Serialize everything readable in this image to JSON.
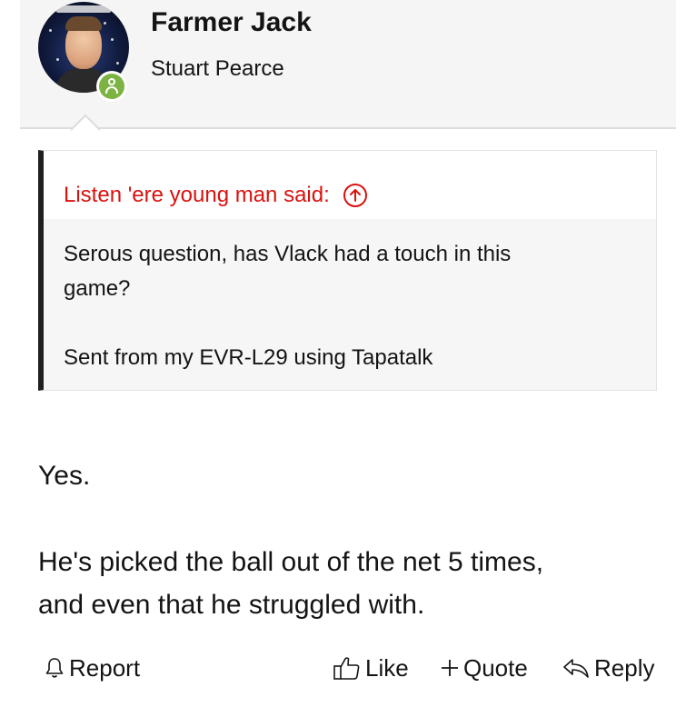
{
  "post": {
    "author": "Farmer Jack",
    "user_title": "Stuart Pearce"
  },
  "quote": {
    "attribution": "Listen 'ere young man said:",
    "lines": [
      "Serous question, has Vlack had a touch in this",
      "game?",
      "Sent from my EVR-L29 using Tapatalk"
    ]
  },
  "message": {
    "lines": [
      "Yes.",
      "He's picked the ball out of the net 5 times,",
      "and even that he struggled with."
    ]
  },
  "actions": {
    "report": "Report",
    "like": "Like",
    "quote": "Quote",
    "reply": "Reply"
  },
  "colors": {
    "quote_attribution": "#d9120f",
    "online_badge": "#7cb342",
    "quote_bar": "#1f1f1f"
  },
  "icons": {
    "online": "user-online-icon",
    "jump_to_quote": "arrow-up-circle-icon",
    "report": "bell-icon",
    "like": "thumbs-up-icon",
    "quote": "plus-icon",
    "reply": "reply-arrow-icon"
  }
}
